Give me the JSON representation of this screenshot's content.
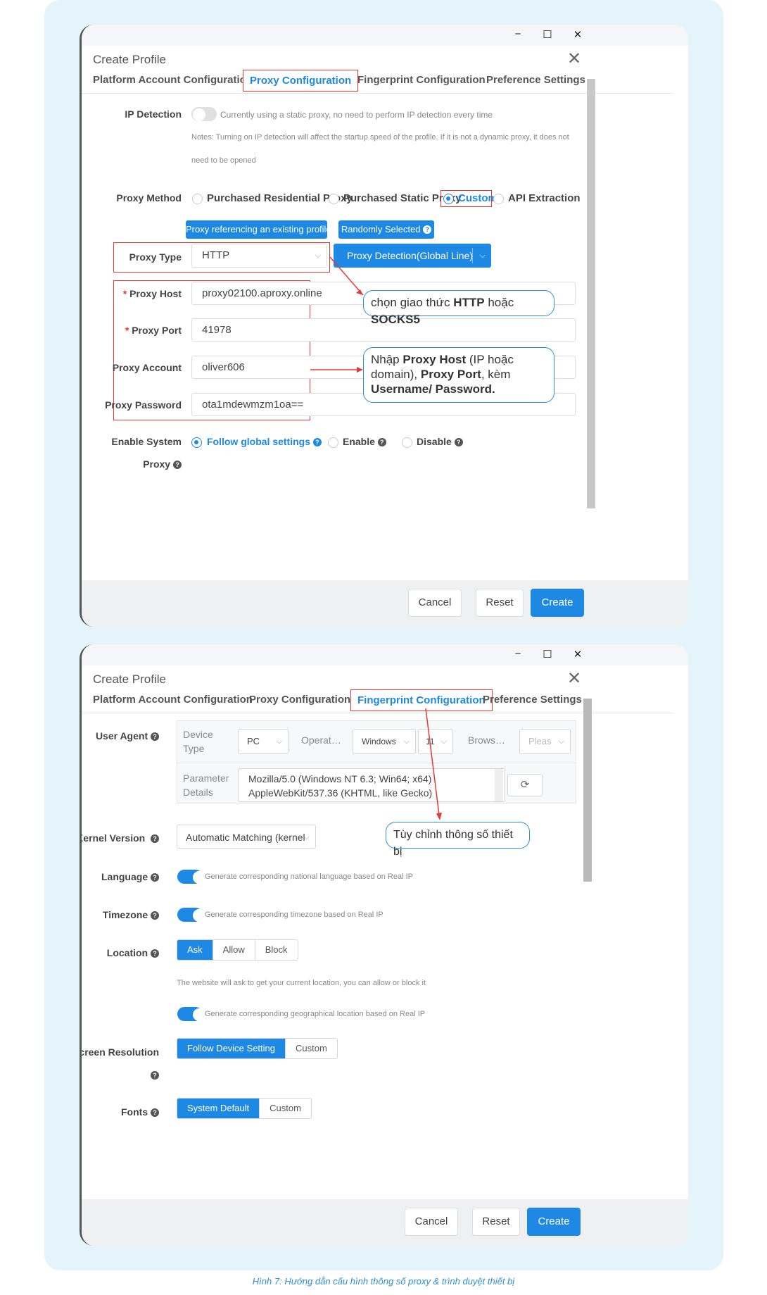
{
  "window_controls": {
    "minimize": "−",
    "maximize": "☐",
    "close": "✕"
  },
  "dialog1": {
    "title": "Create Profile",
    "close": "✕",
    "tabs": [
      "Platform Account Configuration",
      "Proxy Configuration",
      "Fingerprint Configuration",
      "Preference Settings"
    ],
    "active_tab": "Proxy Configuration",
    "ip_detection": {
      "label": "IP Detection",
      "toggle": false,
      "text": "Currently using a static proxy, no need to perform IP detection every time",
      "note1": "Notes: Turning on IP detection will affect the startup speed of the profile. If it is not a dynamic proxy, it does not",
      "note2": "need to be opened"
    },
    "proxy_method": {
      "label": "Proxy Method",
      "options": [
        "Purchased Residential Proxy",
        "Purchased Static Proxy",
        "Custom",
        "API Extraction"
      ],
      "selected": "Custom"
    },
    "buttons": {
      "referencing": "Proxy referencing an existing profile",
      "random": "Randomly Selected"
    },
    "proxy_type": {
      "label": "Proxy Type",
      "value": "HTTP",
      "detect": "Proxy Detection(Global Line)"
    },
    "fields": [
      {
        "label": "Proxy Host",
        "required": "*",
        "value": "proxy02100.aproxy.online"
      },
      {
        "label": "Proxy Port",
        "required": "*",
        "value": "41978"
      },
      {
        "label": "Proxy Account",
        "required": "",
        "value": "oliver606"
      },
      {
        "label": "Proxy Password",
        "required": "",
        "value": "ota1mdewmzm1oa=="
      }
    ],
    "system_proxy": {
      "label1": "Enable System",
      "label2": "Proxy",
      "options": [
        "Follow global settings",
        "Enable",
        "Disable"
      ],
      "selected": "Follow global settings"
    },
    "callout1": {
      "pre": "chọn giao thức ",
      "b1": "HTTP",
      "mid": " hoặc ",
      "b2": "SOCKS5"
    },
    "callout2": {
      "t1": "Nhập ",
      "b1": "Proxy Host",
      "t2": " (IP hoặc domain), ",
      "b2": "Proxy Port",
      "t3": ", kèm ",
      "b3": "Username/ Password."
    },
    "footer": {
      "cancel": "Cancel",
      "reset": "Reset",
      "create": "Create"
    }
  },
  "dialog2": {
    "title": "Create Profile",
    "close": "✕",
    "tabs": [
      "Platform Account Configuration",
      "Proxy Configuration",
      "Fingerprint Configuration",
      "Preference Settings"
    ],
    "active_tab": "Fingerprint Configuration",
    "user_agent": {
      "label": "User Agent",
      "device_type_label": "Device Type",
      "device_type": "PC",
      "os_label": "Operat…",
      "os": "Windows",
      "os_version": "11",
      "browser_label": "Brows…",
      "browser": "Pleas",
      "param_label": "Parameter Details",
      "ua_line1": "Mozilla/5.0 (Windows NT 6.3; Win64; x64)",
      "ua_line2": "AppleWebKit/537.36 (KHTML, like Gecko)"
    },
    "kernel": {
      "label": "Kernel Version",
      "value": "Automatic Matching (kernel"
    },
    "callout": "Tùy chỉnh thông số thiết bị",
    "language": {
      "label": "Language",
      "toggle": true,
      "text": "Generate corresponding national language based on Real IP"
    },
    "timezone": {
      "label": "Timezone",
      "toggle": true,
      "text": "Generate corresponding timezone based on Real IP"
    },
    "location": {
      "label": "Location",
      "options": [
        "Ask",
        "Allow",
        "Block"
      ],
      "selected": "Ask",
      "note": "The website will ask to get your current location, you can allow or block it",
      "toggle": true,
      "toggle_text": "Generate corresponding geographical location based on Real IP"
    },
    "screen_resolution": {
      "label": "Screen Resolution",
      "options": [
        "Follow Device Setting",
        "Custom"
      ],
      "selected": "Follow Device Setting"
    },
    "fonts": {
      "label": "Fonts",
      "options": [
        "System Default",
        "Custom"
      ],
      "selected": "System Default"
    },
    "footer": {
      "cancel": "Cancel",
      "reset": "Reset",
      "create": "Create"
    }
  },
  "caption": "Hình 7:  Hướng dẫn cấu hình thông số proxy & trình duyệt thiết bị",
  "colors": {
    "accent": "#1e88e5",
    "highlight": "#e53935",
    "callout_border": "#2d8fd6",
    "background": "#e5f3fb"
  }
}
